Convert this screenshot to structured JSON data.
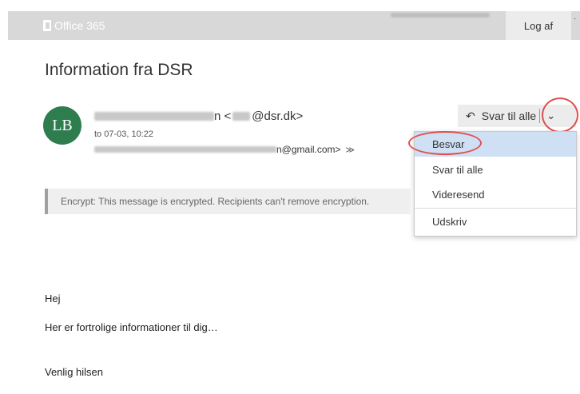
{
  "header": {
    "brand": "Office 365",
    "signout_label": "Log af",
    "corner_mark": "·"
  },
  "message": {
    "subject": "Information fra DSR",
    "avatar_initials": "LB",
    "from_name_suffix": "",
    "from_separator": "n <",
    "from_domain": "@dsr.dk>",
    "date": "to 07-03, 10:22",
    "to_address": "n@gmail.com>",
    "expand_icon": "≫"
  },
  "actions": {
    "reply_all_label": "Svar til alle",
    "reply_icon": "↶",
    "chevron_icon": "⌄"
  },
  "menu": {
    "items": [
      {
        "label": "Besvar",
        "selected": true
      },
      {
        "label": "Svar til alle",
        "selected": false
      },
      {
        "label": "Videresend",
        "selected": false
      },
      {
        "label": "Udskriv",
        "selected": false
      }
    ]
  },
  "encrypt_notice": "Encrypt: This message is encrypted. Recipients can't remove encryption.",
  "body": {
    "greeting": "Hej",
    "line1": "Her er fortrolige informationer til dig…",
    "closing": "Venlig hilsen"
  },
  "colors": {
    "avatar": "#2e7d4f",
    "highlight_circle": "#e05050",
    "selected_item": "#cfe0f5"
  }
}
